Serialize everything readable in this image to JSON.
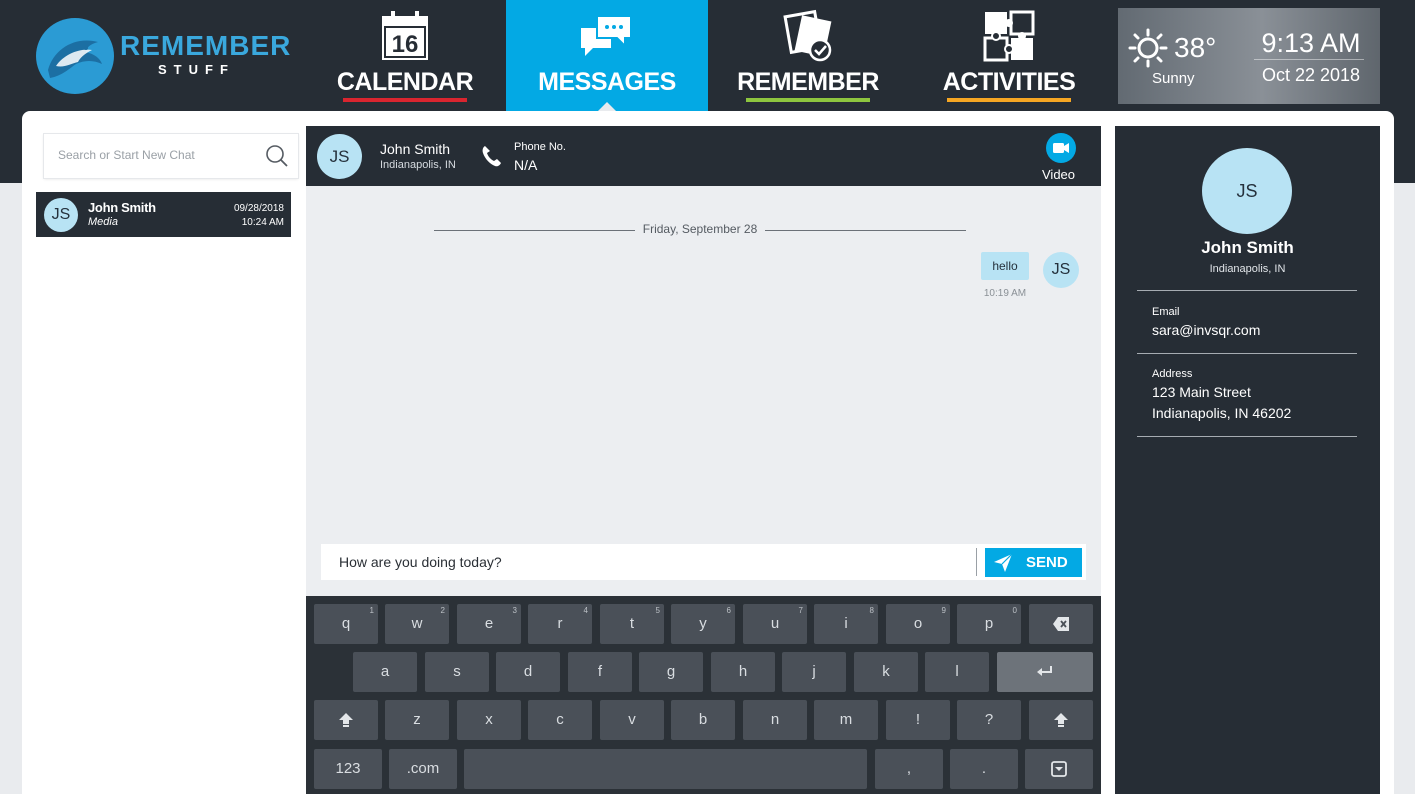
{
  "app": {
    "logo_line1": "REMEMBER",
    "logo_line2": "STUFF"
  },
  "nav": {
    "calendar": {
      "label": "CALENDAR",
      "day": "16",
      "underline_color": "#d9252f"
    },
    "messages": {
      "label": "MESSAGES",
      "active": true
    },
    "remember": {
      "label": "REMEMBER",
      "underline_color": "#8dc63f"
    },
    "activities": {
      "label": "ACTIVITIES",
      "underline_color": "#f5a623"
    }
  },
  "weather": {
    "temp": "38°",
    "condition": "Sunny",
    "time": "9:13 AM",
    "date": "Oct 22 2018"
  },
  "sidebar": {
    "search_placeholder": "Search or Start New Chat",
    "chats": [
      {
        "initials": "JS",
        "name": "John Smith",
        "subtitle": "Media",
        "date": "09/28/2018",
        "time": "10:24 AM"
      }
    ]
  },
  "chat": {
    "contact": {
      "initials": "JS",
      "name": "John Smith",
      "location": "Indianapolis, IN"
    },
    "phone_label": "Phone No.",
    "phone_value": "N/A",
    "video_label": "Video",
    "date_divider": "Friday, September 28",
    "messages": [
      {
        "text": "hello",
        "time": "10:19 AM",
        "initials": "JS"
      }
    ],
    "input_value": "How are you doing today?",
    "send_label": "SEND"
  },
  "keyboard": {
    "row1": [
      {
        "k": "q",
        "n": "1"
      },
      {
        "k": "w",
        "n": "2"
      },
      {
        "k": "e",
        "n": "3"
      },
      {
        "k": "r",
        "n": "4"
      },
      {
        "k": "t",
        "n": "5"
      },
      {
        "k": "y",
        "n": "6"
      },
      {
        "k": "u",
        "n": "7"
      },
      {
        "k": "i",
        "n": "8"
      },
      {
        "k": "o",
        "n": "9"
      },
      {
        "k": "p",
        "n": "0"
      }
    ],
    "row2": [
      "a",
      "s",
      "d",
      "f",
      "g",
      "h",
      "j",
      "k",
      "l"
    ],
    "row3": [
      "z",
      "x",
      "c",
      "v",
      "b",
      "n",
      "m",
      "!",
      "?"
    ],
    "key_123": "123",
    "key_com": ".com",
    "key_comma": ",",
    "key_period": "."
  },
  "profile": {
    "initials": "JS",
    "name": "John Smith",
    "location": "Indianapolis, IN",
    "email_label": "Email",
    "email": "sara@invsqr.com",
    "address_label": "Address",
    "address_line1": "123 Main Street",
    "address_line2": "Indianapolis, IN 46202"
  },
  "colors": {
    "dark": "#262d35",
    "accent": "#03a9e4",
    "avatar": "#b8e3f4"
  }
}
